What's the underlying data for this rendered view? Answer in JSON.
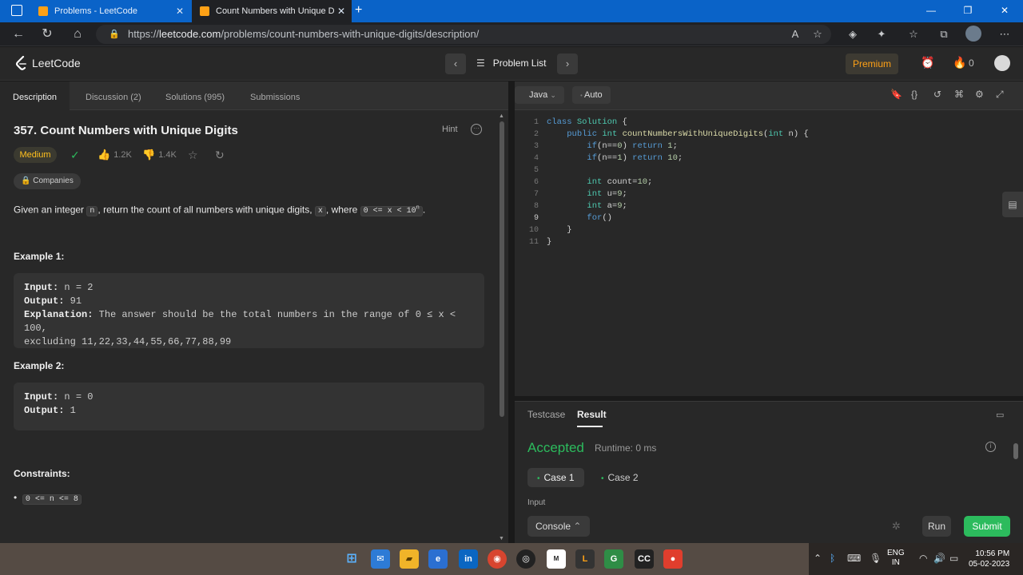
{
  "browser": {
    "tabs": [
      {
        "title": "Problems - LeetCode"
      },
      {
        "title": "Count Numbers with Unique Dig"
      }
    ],
    "url_prefix": "https://",
    "url_host": "leetcode.com",
    "url_path": "/problems/count-numbers-with-unique-digits/description/"
  },
  "header": {
    "logo_text": "LeetCode",
    "problem_list_label": "Problem List",
    "premium_label": "Premium",
    "streak_count": "0"
  },
  "left_tabs": [
    {
      "label": "Description"
    },
    {
      "label": "Discussion (2)"
    },
    {
      "label": "Solutions (995)"
    },
    {
      "label": "Submissions"
    }
  ],
  "problem": {
    "title": "357. Count Numbers with Unique Digits",
    "hint_label": "Hint",
    "difficulty": "Medium",
    "likes": "1.2K",
    "dislikes": "1.4K",
    "companies_label": "Companies",
    "desc_part1": "Given an integer ",
    "desc_code_n": "n",
    "desc_part2": ", return the count of all numbers with unique digits, ",
    "desc_code_x": "x",
    "desc_part3": ", where ",
    "desc_range": "0 <= x < 10",
    "desc_range_sup": "n",
    "desc_part4": ".",
    "example1_title": "Example 1:",
    "example1_input_label": "Input:",
    "example1_input": " n = 2",
    "example1_output_label": "Output:",
    "example1_output": " 91",
    "example1_expl_label": "Explanation:",
    "example1_expl_1": " The answer should be the total numbers in the range of 0 ≤ x < 100,",
    "example1_expl_2": "excluding 11,22,33,44,55,66,77,88,99",
    "example2_title": "Example 2:",
    "example2_input_label": "Input:",
    "example2_input": " n = 0",
    "example2_output_label": "Output:",
    "example2_output": " 1",
    "constraints_title": "Constraints:",
    "constraint1": "0 <= n <= 8"
  },
  "editor": {
    "language": "Java",
    "mode": "Auto",
    "current_line": 9,
    "lines": [
      "class Solution {",
      "    public int countNumbersWithUniqueDigits(int n) {",
      "        if(n==0) return 1;",
      "        if(n==1) return 10;",
      "",
      "        int count=10;",
      "        int u=9;",
      "        int a=9;",
      "        for()",
      "    }",
      "}"
    ]
  },
  "result": {
    "tab_testcase": "Testcase",
    "tab_result": "Result",
    "status": "Accepted",
    "runtime": "Runtime: 0 ms",
    "case1": "Case 1",
    "case2": "Case 2",
    "input_label": "Input",
    "console_label": "Console",
    "run_label": "Run",
    "submit_label": "Submit"
  },
  "taskbar": {
    "lang_1": "ENG",
    "lang_2": "IN",
    "time": "10:56 PM",
    "date": "05-02-2023"
  },
  "colors": {
    "accent_orange": "#ffa116",
    "medium_yellow": "#ffc01e",
    "success_green": "#2cbb5d",
    "browser_blue": "#0a63c8"
  }
}
